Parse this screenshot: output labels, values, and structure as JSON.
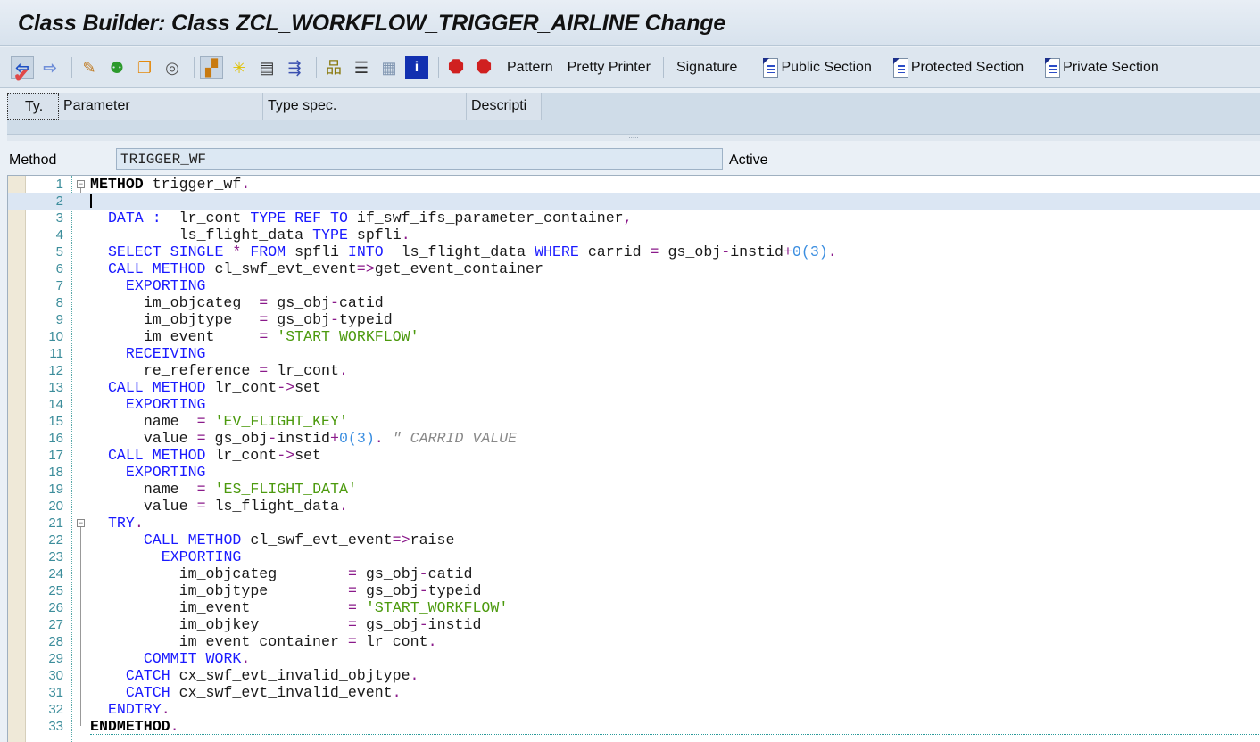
{
  "title": "Class Builder: Class ZCL_WORKFLOW_TRIGGER_AIRLINE Change",
  "toolbar": {
    "icons": [
      "back-icon",
      "forward-icon",
      "edit-icon",
      "activate-icon",
      "other-object-icon",
      "where-used-icon",
      "display-object-list-icon",
      "breakpoint-icon",
      "signature-icon",
      "navigate-icon",
      "hierarchy-icon",
      "stack-icon",
      "layout-icon",
      "info-icon",
      "stop-icon",
      "stop-user-icon"
    ],
    "pattern": "Pattern",
    "pretty_printer": "Pretty Printer",
    "signature": "Signature",
    "public_section": "Public Section",
    "protected_section": "Protected Section",
    "private_section": "Private Section"
  },
  "params": {
    "columns": [
      "Ty.",
      "Parameter",
      "Type spec.",
      "Descripti"
    ]
  },
  "method": {
    "label": "Method",
    "value": "TRIGGER_WF",
    "status": "Active"
  },
  "code": [
    "METHOD trigger_wf.",
    "",
    "  DATA :  lr_cont TYPE REF TO if_swf_ifs_parameter_container,",
    "          ls_flight_data TYPE spfli.",
    "  SELECT SINGLE * FROM spfli INTO  ls_flight_data WHERE carrid = gs_obj-instid+0(3).",
    "  CALL METHOD cl_swf_evt_event=>get_event_container",
    "    EXPORTING",
    "      im_objcateg  = gs_obj-catid",
    "      im_objtype   = gs_obj-typeid",
    "      im_event     = 'START_WORKFLOW'",
    "    RECEIVING",
    "      re_reference = lr_cont.",
    "  CALL METHOD lr_cont->set",
    "    EXPORTING",
    "      name  = 'EV_FLIGHT_KEY'",
    "      value = gs_obj-instid+0(3). \" CARRID VALUE",
    "  CALL METHOD lr_cont->set",
    "    EXPORTING",
    "      name  = 'ES_FLIGHT_DATA'",
    "      value = ls_flight_data.",
    "  TRY.",
    "      CALL METHOD cl_swf_evt_event=>raise",
    "        EXPORTING",
    "          im_objcateg        = gs_obj-catid",
    "          im_objtype         = gs_obj-typeid",
    "          im_event           = 'START_WORKFLOW'",
    "          im_objkey          = gs_obj-instid",
    "          im_event_container = lr_cont.",
    "      COMMIT WORK.",
    "    CATCH cx_swf_evt_invalid_objtype.",
    "    CATCH cx_swf_evt_invalid_event.",
    "  ENDTRY.",
    "ENDMETHOD."
  ]
}
